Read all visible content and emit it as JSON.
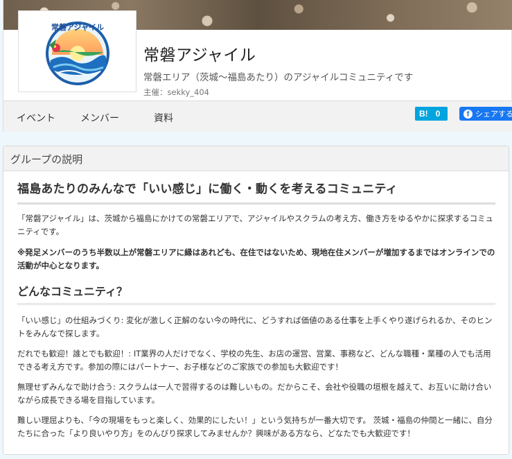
{
  "group": {
    "title": "常磐アジャイル",
    "subtitle": "常磐エリア（茨城〜福島あたり）のアジャイルコミュニティです",
    "organizer_label": "主催：",
    "organizer_name": "sekky_404",
    "logo_text": "常磐アジャイル"
  },
  "nav": {
    "events": "イベント",
    "members": "メンバー",
    "materials": "資料"
  },
  "share": {
    "hatena_label": "B!",
    "hatena_count": "0",
    "facebook_icon": "f",
    "facebook_label": "シェアする"
  },
  "description": {
    "header": "グループの説明",
    "main_heading": "福島あたりのみんなで「いい感じ」に働く・動くを考えるコミュニティ",
    "intro": "「常磐アジャイル」は、茨城から福島にかけての常磐エリアで、アジャイルやスクラムの考え方、働き方をゆるやかに探求するコミュニティです。",
    "note": "※発足メンバーのうち半数以上が常磐エリアに縁はあれども、在住ではないため、現地在住メンバーが増加するまではオンラインでの活動が中心となります。",
    "sub_heading": "どんなコミュニティ？",
    "points": [
      "「いい感じ」の仕組みづくり: 変化が激しく正解のない今の時代に、どうすれば価値のある仕事を上手くやり遂げられるか、そのヒントをみんなで探します。",
      "だれでも歓迎！誰とでも歓迎！: IT業界の人だけでなく、学校の先生、お店の運営、営業、事務など、どんな職種・業種の人でも活用できる考え方です。参加の際にはパートナー、お子様などのご家族での参加も大歓迎です！",
      "無理せずみんなで助け合う: スクラムは一人で習得するのは難しいもの。だからこそ、会社や役職の垣根を越えて、お互いに助け合いながら成長できる場を目指しています。",
      "難しい理屈よりも、「今の現場をもっと楽しく、効果的にしたい！」という気持ちが一番大切です。 茨城・福島の仲間と一緒に、自分たちに合った「より良いやり方」をのんびり探求してみませんか？興味がある方なら、どなたでも大歓迎です！"
    ]
  },
  "colors": {
    "page_bg": "#eef7fb",
    "hatena": "#00a4de",
    "facebook": "#1877f2"
  }
}
